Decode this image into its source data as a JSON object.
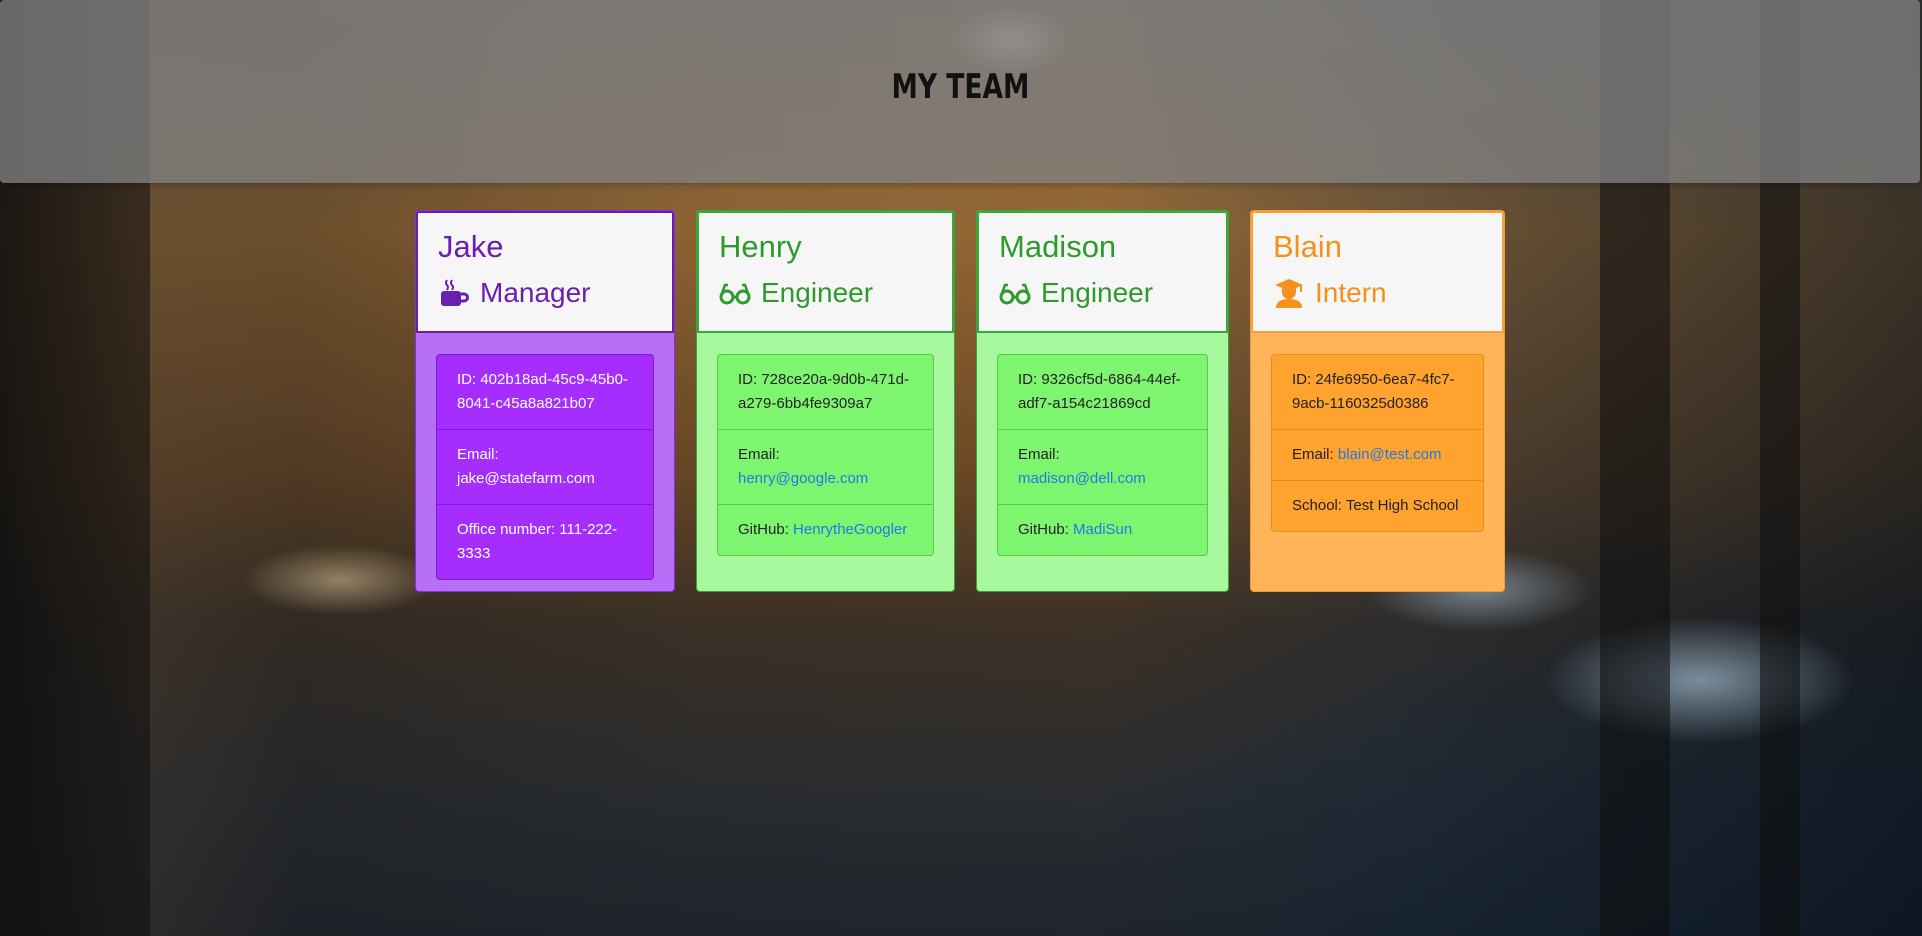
{
  "header": {
    "title": "MY TEAM"
  },
  "colors": {
    "manager": "#a52eff",
    "engineer": "#7ef56f",
    "intern": "#ffa32e",
    "link": "#1e7be6"
  },
  "team": [
    {
      "name": "Jake",
      "role": "Manager",
      "icon": "coffee-icon",
      "id": "ID: 402b18ad-45c9-45b0-8041-c45a8a821b07",
      "email_label": "Email:",
      "email": "jake@statefarm.com",
      "extra": "Office number: 111-222-3333"
    },
    {
      "name": "Henry",
      "role": "Engineer",
      "icon": "glasses-icon",
      "id": "ID: 728ce20a-9d0b-471d-a279-6bb4fe9309a7",
      "email_label": "Email:",
      "email": "henry@google.com",
      "extra_label": "GitHub:",
      "extra_value": "HenrytheGoogler"
    },
    {
      "name": "Madison",
      "role": "Engineer",
      "icon": "glasses-icon",
      "id": "ID: 9326cf5d-6864-44ef-adf7-a154c21869cd",
      "email_label": "Email:",
      "email": "madison@dell.com",
      "extra_label": "GitHub:",
      "extra_value": "MadiSun"
    },
    {
      "name": "Blain",
      "role": "Intern",
      "icon": "graduate-icon",
      "id": "ID: 24fe6950-6ea7-4fc7-9acb-1160325d0386",
      "email_label": "Email:",
      "email": "blain@test.com",
      "extra": "School: Test High School"
    }
  ]
}
